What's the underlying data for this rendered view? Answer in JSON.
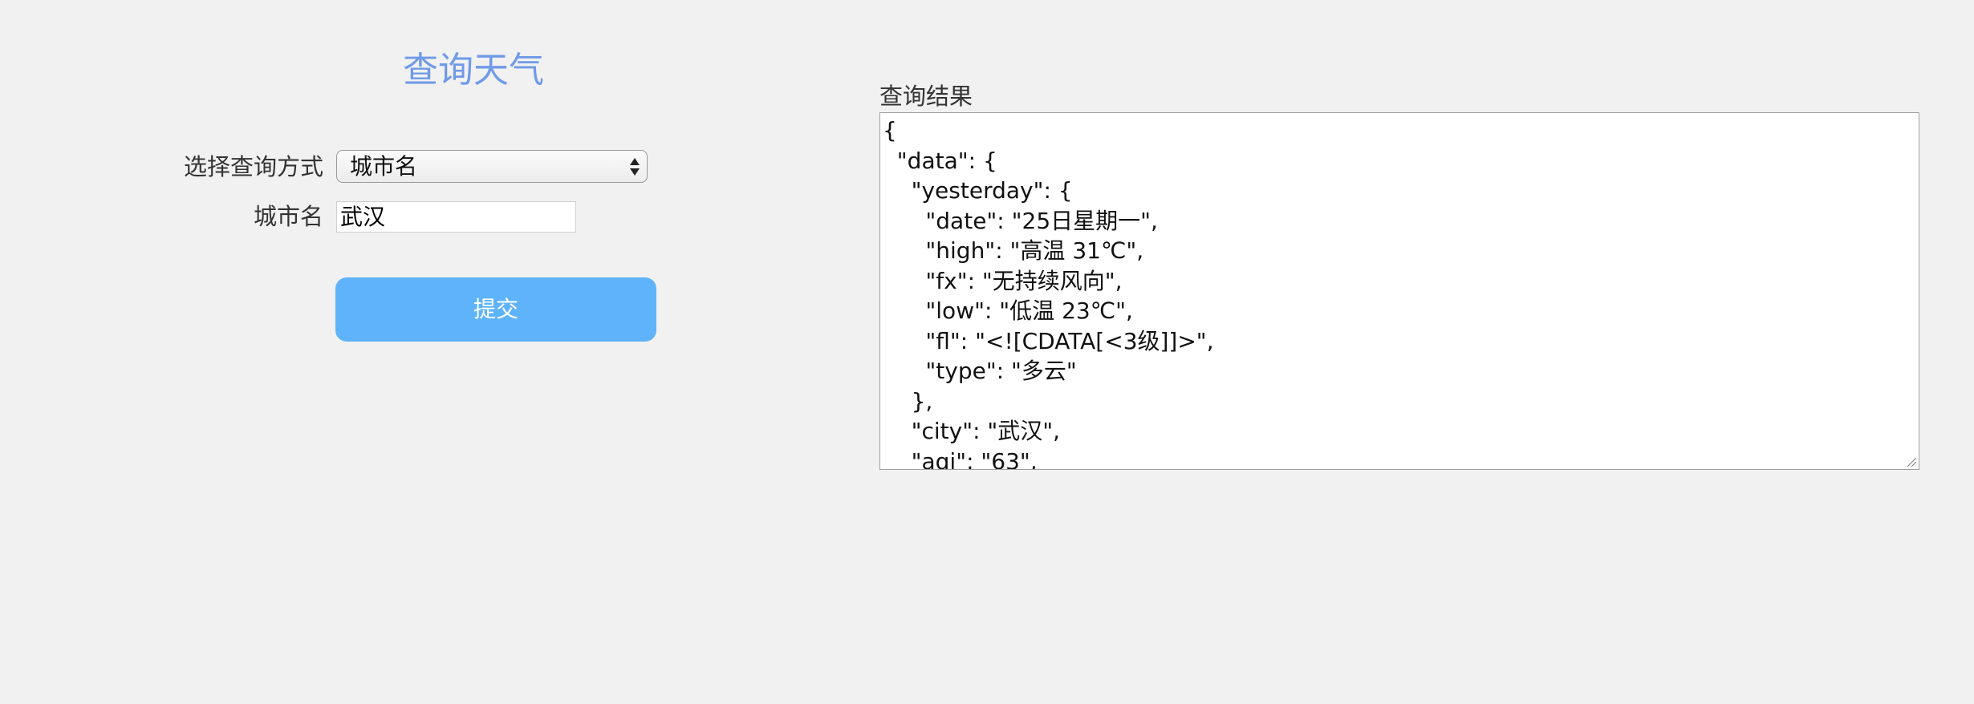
{
  "page": {
    "title": "查询天气"
  },
  "form": {
    "method_label": "选择查询方式",
    "method_selected": "城市名",
    "city_label": "城市名",
    "city_value": "武汉",
    "submit_label": "提交"
  },
  "result": {
    "label": "查询结果",
    "content": "{\n  \"data\": {\n    \"yesterday\": {\n      \"date\": \"25日星期一\",\n      \"high\": \"高温 31℃\",\n      \"fx\": \"无持续风向\",\n      \"low\": \"低温 23℃\",\n      \"fl\": \"<![CDATA[<3级]]>\",\n      \"type\": \"多云\"\n    },\n    \"city\": \"武汉\",\n    \"aqi\": \"63\","
  },
  "colors": {
    "background": "#f1f1f1",
    "title": "#6f9ae8",
    "button": "#5eb3fb"
  }
}
